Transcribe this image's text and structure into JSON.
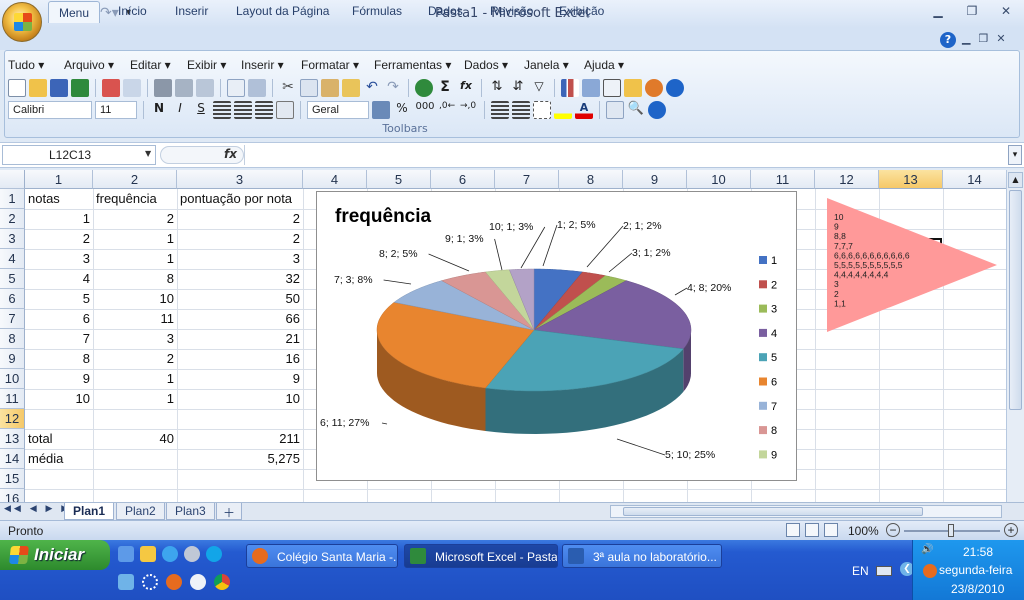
{
  "window": {
    "title": "Pasta1 - Microsoft Excel",
    "controls": [
      "▁",
      "❐",
      "✕"
    ]
  },
  "ribbon": {
    "tabs": [
      "Menu",
      "Início",
      "Inserir",
      "Layout da Página",
      "Fórmulas",
      "Dados",
      "Revisão",
      "Exibição"
    ],
    "active_tab": "Menu",
    "menus": [
      "Tudo ▾",
      "Arquivo ▾",
      "Editar ▾",
      "Exibir ▾",
      "Inserir ▾",
      "Formatar ▾",
      "Ferramentas ▾",
      "Dados ▾",
      "Janela ▾",
      "Ajuda ▾"
    ],
    "group_label": "Toolbars",
    "help": "?",
    "font": "Calibri",
    "size": "11",
    "number_format": "Geral",
    "bold": "N",
    "italic": "I",
    "strike": "S",
    "percent": "%",
    "thousands": "000",
    "sigma": "Σ",
    "fxbtn": "fx"
  },
  "formula_bar": {
    "name_box": "L12C13",
    "fx": "fx",
    "value": ""
  },
  "columns": [
    "1",
    "2",
    "3",
    "4",
    "5",
    "6",
    "7",
    "8",
    "9",
    "10",
    "11",
    "12",
    "13",
    "14"
  ],
  "rows": [
    "1",
    "2",
    "3",
    "4",
    "5",
    "6",
    "7",
    "8",
    "9",
    "10",
    "11",
    "12",
    "13",
    "14",
    "15",
    "16"
  ],
  "cells": {
    "r1": {
      "c1": "notas",
      "c2": "frequência",
      "c3": "pontuação por nota"
    },
    "data": [
      [
        "1",
        "2",
        "2"
      ],
      [
        "2",
        "1",
        "2"
      ],
      [
        "3",
        "1",
        "3"
      ],
      [
        "4",
        "8",
        "32"
      ],
      [
        "5",
        "10",
        "50"
      ],
      [
        "6",
        "11",
        "66"
      ],
      [
        "7",
        "3",
        "21"
      ],
      [
        "8",
        "2",
        "16"
      ],
      [
        "9",
        "1",
        "9"
      ],
      [
        "10",
        "1",
        "10"
      ]
    ],
    "r13": {
      "c1": "total",
      "c2": "40",
      "c3": "211"
    },
    "r14": {
      "c1": "média",
      "c3": "5,275"
    }
  },
  "chart_data": {
    "type": "pie",
    "title": "frequência",
    "categories": [
      "1",
      "2",
      "3",
      "4",
      "5",
      "6",
      "7",
      "8",
      "9",
      "10"
    ],
    "values": [
      2,
      1,
      1,
      8,
      10,
      11,
      3,
      2,
      1,
      1
    ],
    "data_labels": [
      "1; 2; 5%",
      "2; 1; 2%",
      "3; 1; 2%",
      "4; 8; 20%",
      "5; 10; 25%",
      "6; 11; 27%",
      "7; 3; 8%",
      "8; 2; 5%",
      "9; 1; 3%",
      "10; 1; 3%"
    ],
    "legend_entries": [
      "1",
      "2",
      "3",
      "4",
      "5",
      "6",
      "7",
      "8",
      "9"
    ],
    "colors": [
      "#4472c4",
      "#c0504d",
      "#9bbb59",
      "#7a5fa0",
      "#4ba3b6",
      "#e8852f",
      "#98b3d8",
      "#d99694",
      "#c3d69b",
      "#b3a2c7"
    ],
    "legend_position": "right",
    "style": "3D"
  },
  "shape": {
    "lines": [
      "10",
      "9",
      "8,8",
      "7,7,7",
      "6,6,6,6,6,6,6,6,6,6,6",
      "5,5,5,5,5,5,5,5,5,5",
      "4,4,4,4,4,4,4,4",
      "3",
      "2",
      "1,1"
    ],
    "color": "#ff9999"
  },
  "sheets": [
    "Plan1",
    "Plan2",
    "Plan3"
  ],
  "active_sheet": "Plan1",
  "status": {
    "text": "Pronto",
    "zoom": "100%"
  },
  "taskbar": {
    "start": "Iniciar",
    "items": [
      "Colégio Santa Maria -...",
      "Microsoft Excel - Pasta1",
      "3ª aula no laboratório..."
    ],
    "lang": "EN",
    "time": "21:58",
    "day": "segunda-feira",
    "date": "23/8/2010"
  }
}
